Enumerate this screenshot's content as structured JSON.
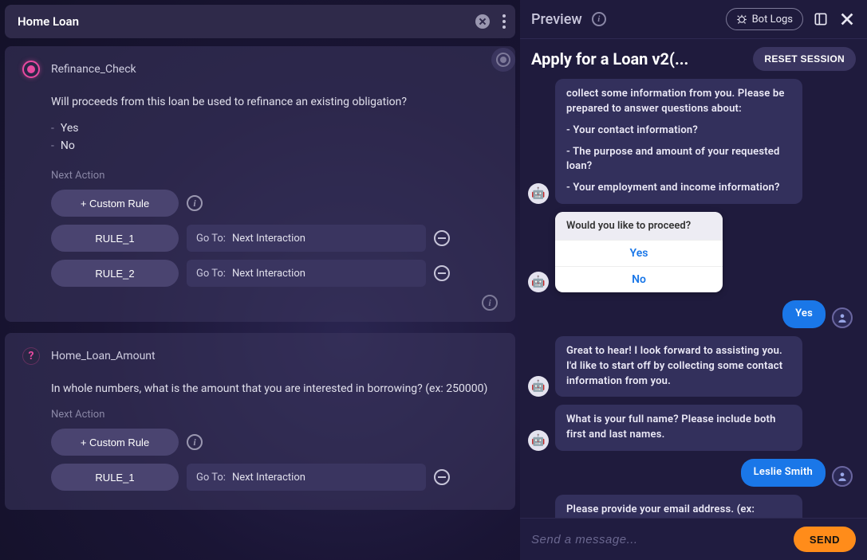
{
  "header": {
    "title": "Home Loan"
  },
  "nodes": [
    {
      "kind": "radio",
      "name": "Refinance_Check",
      "question": "Will proceeds from this loan be used to refinance an existing obligation?",
      "options": [
        "Yes",
        "No"
      ],
      "next_action_label": "Next Action",
      "custom_rule_label": "+ Custom Rule",
      "rules": [
        {
          "label": "RULE_1",
          "goto_label": "Go To:",
          "goto_value": "Next Interaction"
        },
        {
          "label": "RULE_2",
          "goto_label": "Go To:",
          "goto_value": "Next Interaction"
        }
      ]
    },
    {
      "kind": "question",
      "name": "Home_Loan_Amount",
      "question": "In whole numbers, what is the amount that you are interested in borrowing?  (ex: 250000)",
      "options": [],
      "next_action_label": "Next Action",
      "custom_rule_label": "+ Custom Rule",
      "rules": [
        {
          "label": "RULE_1",
          "goto_label": "Go To:",
          "goto_value": "Next Interaction"
        }
      ]
    }
  ],
  "preview": {
    "title": "Preview",
    "bot_logs_label": "Bot Logs",
    "subtitle": "Apply for a Loan v2(...",
    "reset_label": "RESET SESSION",
    "composer_placeholder": "Send a message...",
    "send_label": "SEND",
    "messages": [
      {
        "role": "bot",
        "type": "text",
        "lines": [
          "collect some information from you. Please be prepared to answer questions about:",
          "- Your contact information?",
          "- The purpose and amount of your requested loan?",
          "- Your employment and income information?"
        ]
      },
      {
        "role": "bot",
        "type": "choice",
        "prompt": "Would you like to proceed?",
        "choices": [
          "Yes",
          "No"
        ]
      },
      {
        "role": "user",
        "type": "text",
        "lines": [
          "Yes"
        ]
      },
      {
        "role": "bot",
        "type": "text",
        "lines": [
          "Great to hear! I look forward to assisting you. I'd like to start off by collecting some contact information from you."
        ]
      },
      {
        "role": "bot",
        "type": "text",
        "lines": [
          "What is your full name? Please include both first and last names."
        ]
      },
      {
        "role": "user",
        "type": "text",
        "lines": [
          "Leslie Smith"
        ]
      },
      {
        "role": "bot",
        "type": "text",
        "lines": [
          "Please provide your email address. (ex: name@email.com)"
        ]
      }
    ]
  }
}
